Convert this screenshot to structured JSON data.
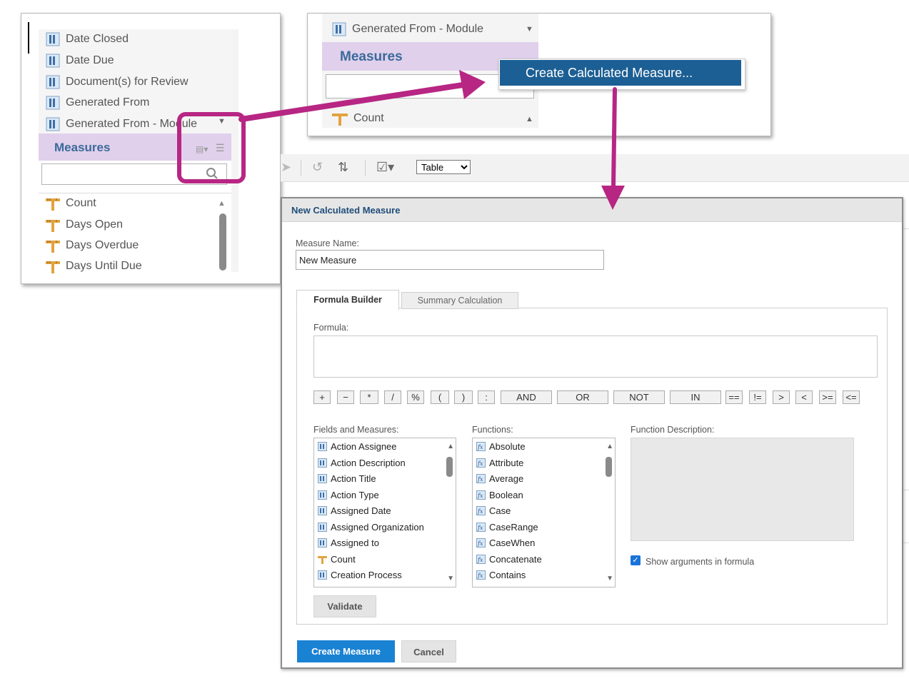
{
  "left_panel": {
    "field_items": [
      "Date Closed",
      "Date Due",
      "Document(s) for Review",
      "Generated From",
      "Generated From - Module"
    ],
    "measures_title": "Measures",
    "measure_items": [
      "Count",
      "Days Open",
      "Days Overdue",
      "Days Until Due"
    ]
  },
  "top_panel": {
    "field_item": "Generated From - Module",
    "measures_title": "Measures",
    "context_menu_item": "Create Calculated Measure...",
    "measure_item": "Count"
  },
  "toolbar": {
    "view_select": "Table",
    "view_options": [
      "Table"
    ]
  },
  "dialog": {
    "title": "New Calculated Measure",
    "measure_name_label": "Measure Name:",
    "measure_name_value": "New Measure",
    "tabs": [
      "Formula Builder",
      "Summary Calculation"
    ],
    "formula_label": "Formula:",
    "operators": [
      "+",
      "−",
      "*",
      "/",
      "%",
      "(",
      ")",
      ":",
      "AND",
      "OR",
      "NOT",
      "IN",
      "==",
      "!=",
      ">",
      "<",
      ">=",
      "<="
    ],
    "fields_label": "Fields and Measures:",
    "fields": [
      "Action Assignee",
      "Action Description",
      "Action Title",
      "Action Type",
      "Assigned Date",
      "Assigned Organization",
      "Assigned to",
      "Count",
      "Creation Process"
    ],
    "functions_label": "Functions:",
    "functions": [
      "Absolute",
      "Attribute",
      "Average",
      "Boolean",
      "Case",
      "CaseRange",
      "CaseWhen",
      "Concatenate",
      "Contains"
    ],
    "function_description_label": "Function Description:",
    "show_arguments_label": "Show arguments in formula",
    "show_arguments_checked": true,
    "validate_label": "Validate",
    "create_label": "Create Measure",
    "cancel_label": "Cancel"
  },
  "colors": {
    "annotation": "#b72683",
    "measures_bar": "#e0d0ec",
    "menu_highlight": "#1c5f94",
    "primary_button": "#1a82d3",
    "dialog_title": "#1f4e79"
  },
  "icons": {
    "field": "dimension-field-icon",
    "measure": "measure-ruler-icon",
    "function": "function-fx-icon"
  }
}
